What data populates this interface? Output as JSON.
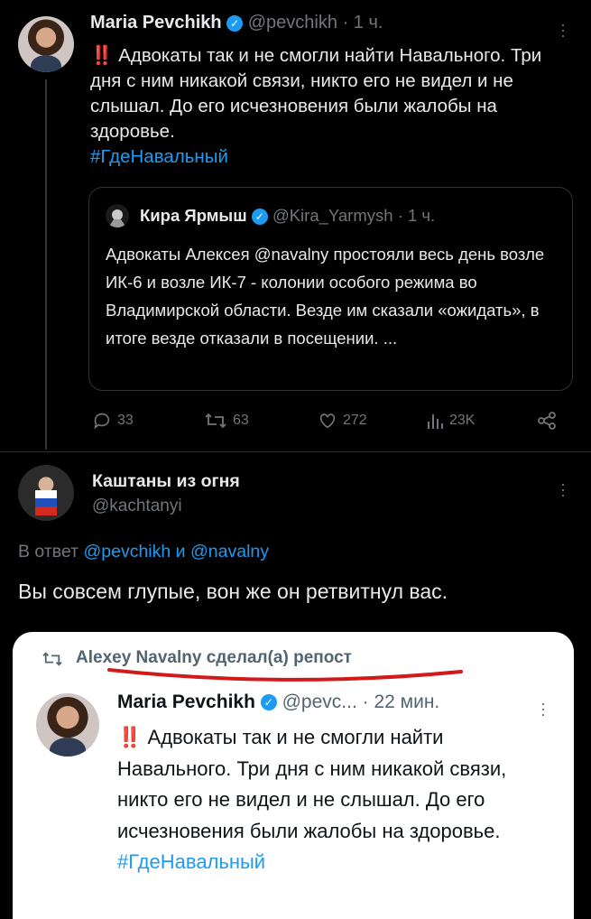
{
  "tweet1": {
    "author_name": "Maria Pevchikh",
    "handle": "@pevchikh",
    "time": "· 1 ч.",
    "bang": "‼️",
    "text": "Адвокаты так и не смогли найти Навального. Три дня с ним никакой связи, никто его не видел и не слышал. До его исчезновения были жалобы на здоровье.",
    "hashtag": "#ГдеНавальный"
  },
  "quote": {
    "author_name": "Кира Ярмыш",
    "handle": "@Kira_Yarmysh",
    "time": "· 1 ч.",
    "text": "Адвокаты Алексея @navalny простояли весь день возле ИК-6 и возле ИК-7 - колонии особого режима во Владимирской области. Везде им сказали «ожидать», в итоге везде отказали в посещении. ..."
  },
  "actions": {
    "replies": "33",
    "reposts": "63",
    "likes": "272",
    "views": "23K"
  },
  "reply": {
    "author_name": "Каштаны из огня",
    "handle": "@kachtanyi",
    "reply_prefix": "В ответ",
    "reply_to_1": "@pevchikh",
    "reply_and": "и",
    "reply_to_2": "@navalny",
    "text": "Вы совсем глупые, вон же он ретвитнул вас."
  },
  "card": {
    "repost_label": "Alexey Navalny сделал(а) репост",
    "author_name": "Maria Pevchikh",
    "handle": "@pevc...",
    "time": "· 22 мин.",
    "bang": "‼️",
    "text": "Адвокаты так и не смогли найти Навального. Три дня с ним никакой связи, никто его не видел и не слышал. До его исчезновения были жалобы на здоровье.",
    "hashtag": "#ГдеНавальный"
  },
  "colors": {
    "accent": "#1d9bf0",
    "underline": "#d11a1a",
    "background": "#000000"
  }
}
